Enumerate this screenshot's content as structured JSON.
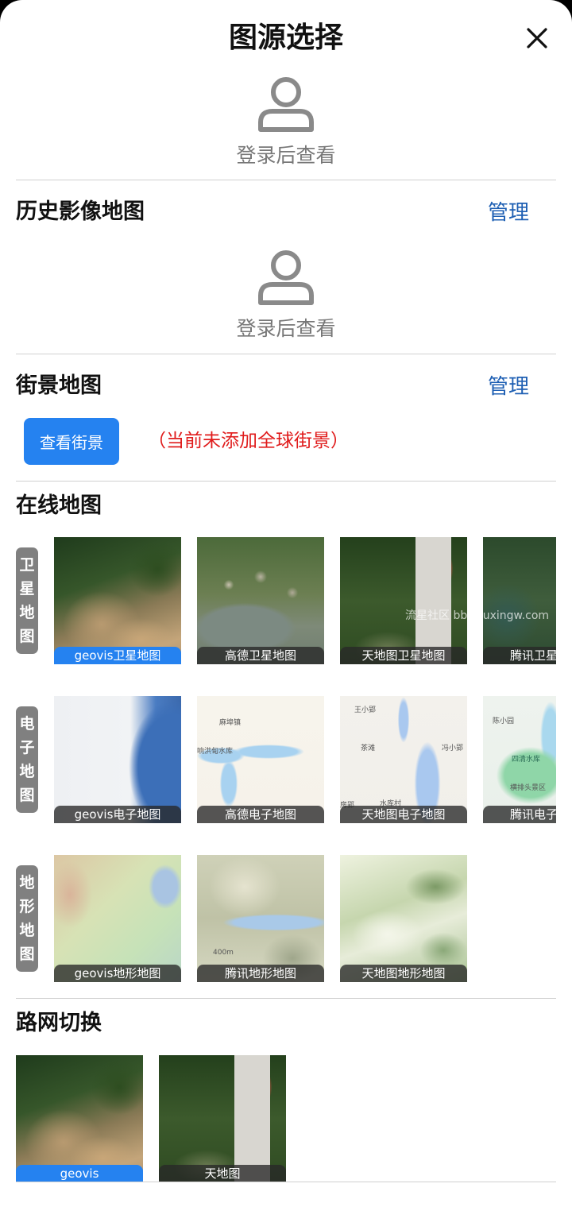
{
  "header": {
    "title": "图源选择"
  },
  "login": {
    "prompt": "登录后查看"
  },
  "history": {
    "title": "历史影像地图",
    "manage": "管理"
  },
  "street": {
    "title": "街景地图",
    "manage": "管理",
    "view_button": "查看街景",
    "note": "（当前未添加全球街景）"
  },
  "online": {
    "title": "在线地图",
    "rows": [
      {
        "label": [
          "卫",
          "星",
          "地",
          "图"
        ],
        "tiles": [
          "geovis卫星地图",
          "高德卫星地图",
          "天地图卫星地图",
          "腾讯卫星地图"
        ]
      },
      {
        "label": [
          "电",
          "子",
          "地",
          "图"
        ],
        "tiles": [
          "geovis电子地图",
          "高德电子地图",
          "天地图电子地图",
          "腾讯电子地图"
        ]
      },
      {
        "label": [
          "地",
          "形",
          "地",
          "图"
        ],
        "tiles": [
          "geovis地形地图",
          "腾讯地形地图",
          "天地图地形地图"
        ]
      }
    ]
  },
  "road": {
    "title": "路网切换",
    "tiles": [
      "geovis",
      "天地图"
    ]
  },
  "watermark": "流星社区 bbs.liuxingw.com",
  "map_text": {
    "gaode_1": "麻埠镇",
    "gaode_2": "响洪甸水库",
    "tdt_1": "王小郢",
    "tdt_2": "茶滩",
    "tdt_3": "冯小郢",
    "tdt_4": "水库村",
    "tdt_5": "房郢",
    "tx_1": "陈小园",
    "tx_2": "四清水库",
    "tx_3": "横排头景区",
    "ter_1": "400m"
  },
  "colors": {
    "accent": "#2582f0",
    "link": "#1e5fb3",
    "warning": "#e01b1b"
  }
}
